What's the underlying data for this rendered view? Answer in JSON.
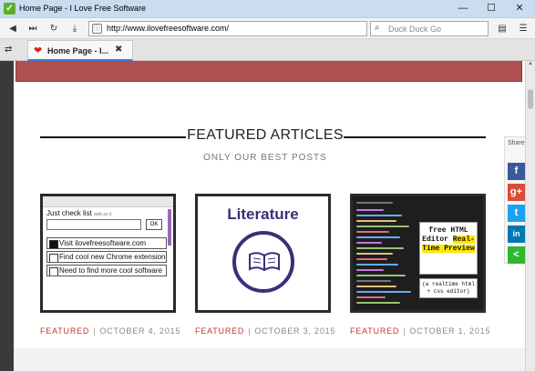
{
  "window": {
    "title": "Home Page - I Love Free Software",
    "app_icon": "checkmark-app-icon",
    "minimize": "—",
    "maximize": "☐",
    "close": "✕"
  },
  "navigation": {
    "back_icon": "back-arrow-icon",
    "forward_icon": "fast-forward-icon",
    "reload_icon": "reload-icon",
    "download_icon": "download-icon",
    "url": "http://www.ilovefreesoftware.com/",
    "search_placeholder": "Duck Duck Go",
    "reader_icon": "reader-icon",
    "menu_icon": "menu-icon"
  },
  "tabs": [
    {
      "label": "Home Page - I...",
      "favicon": "heart-icon",
      "close": "✖"
    }
  ],
  "page": {
    "section_title": "FEATURED ARTICLES",
    "section_subtitle": "ONLY OUR BEST POSTS",
    "articles": [
      {
        "category": "FEATURED",
        "date": "OCTOBER 4, 2015",
        "thumb": {
          "title": "Just check list",
          "title_small": "avik as it",
          "ok": "OK",
          "items": [
            "Visit ilovefreesoftware.com",
            "Find cool new Chrome extensions",
            "Need to find more cool software"
          ]
        }
      },
      {
        "category": "FEATURED",
        "date": "OCTOBER 3, 2015",
        "thumb": {
          "title": "Literature"
        }
      },
      {
        "category": "FEATURED",
        "date": "OCTOBER 1, 2015",
        "thumb": {
          "line1": "free HTML",
          "line2": "Editor",
          "highlight1": "Real-",
          "highlight2": "Time Preview",
          "sub": "(a realtime html + css editor)"
        }
      }
    ],
    "separator": "|"
  },
  "share": {
    "label": "Share",
    "buttons": [
      {
        "name": "facebook",
        "glyph": "f"
      },
      {
        "name": "google-plus",
        "glyph": "g+"
      },
      {
        "name": "twitter",
        "glyph": "t"
      },
      {
        "name": "linkedin",
        "glyph": "in"
      },
      {
        "name": "share",
        "glyph": "<"
      }
    ]
  },
  "colors": {
    "accent_red": "#c0392b",
    "banner": "#b05050",
    "tab_indicator": "#3a7bd5"
  }
}
